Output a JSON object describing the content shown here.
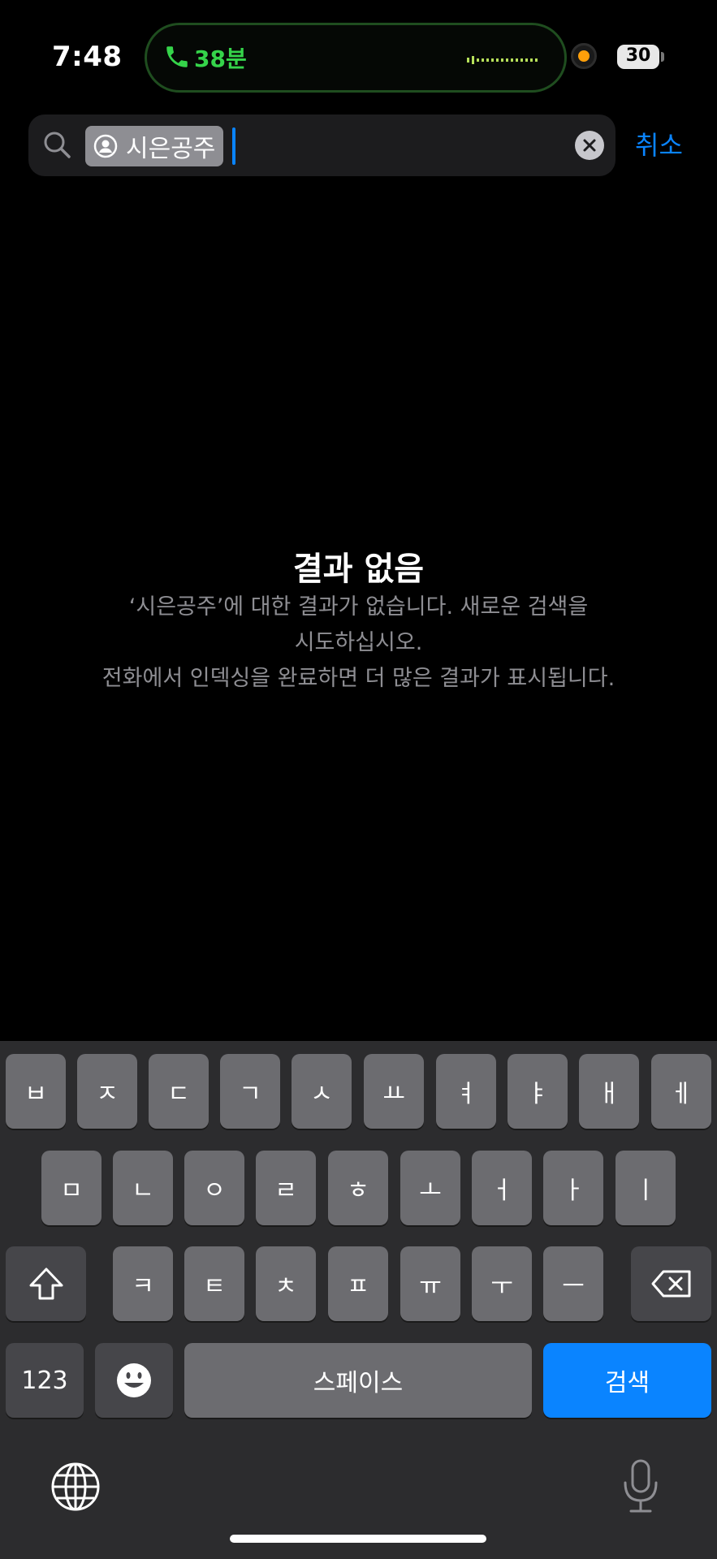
{
  "status_bar": {
    "time": "7:48",
    "call_duration": "38분",
    "battery": "30"
  },
  "search": {
    "token_label": "시은공주",
    "cancel_label": "취소"
  },
  "empty_state": {
    "title": "결과 없음",
    "message_line1": "‘시은공주’에 대한 결과가 없습니다. 새로운 검색을",
    "message_line2": "시도하십시오.",
    "message_line3": "전화에서 인덱싱을 완료하면 더 많은 결과가 표시됩니다."
  },
  "keyboard": {
    "row1": [
      "ㅂ",
      "ㅈ",
      "ㄷ",
      "ㄱ",
      "ㅅ",
      "ㅛ",
      "ㅕ",
      "ㅑ",
      "ㅐ",
      "ㅔ"
    ],
    "row2": [
      "ㅁ",
      "ㄴ",
      "ㅇ",
      "ㄹ",
      "ㅎ",
      "ㅗ",
      "ㅓ",
      "ㅏ",
      "ㅣ"
    ],
    "row3": [
      "ㅋ",
      "ㅌ",
      "ㅊ",
      "ㅍ",
      "ㅠ",
      "ㅜ",
      "ㅡ"
    ],
    "numbers_label": "123",
    "space_label": "스페이스",
    "search_label": "검색",
    "icons": [
      "shift-icon",
      "delete-icon",
      "emoji-icon",
      "globe-icon",
      "mic-icon"
    ]
  },
  "colors": {
    "accent": "#0a84ff",
    "call_green": "#35d44a",
    "recording_dot": "#ff9f0a"
  }
}
